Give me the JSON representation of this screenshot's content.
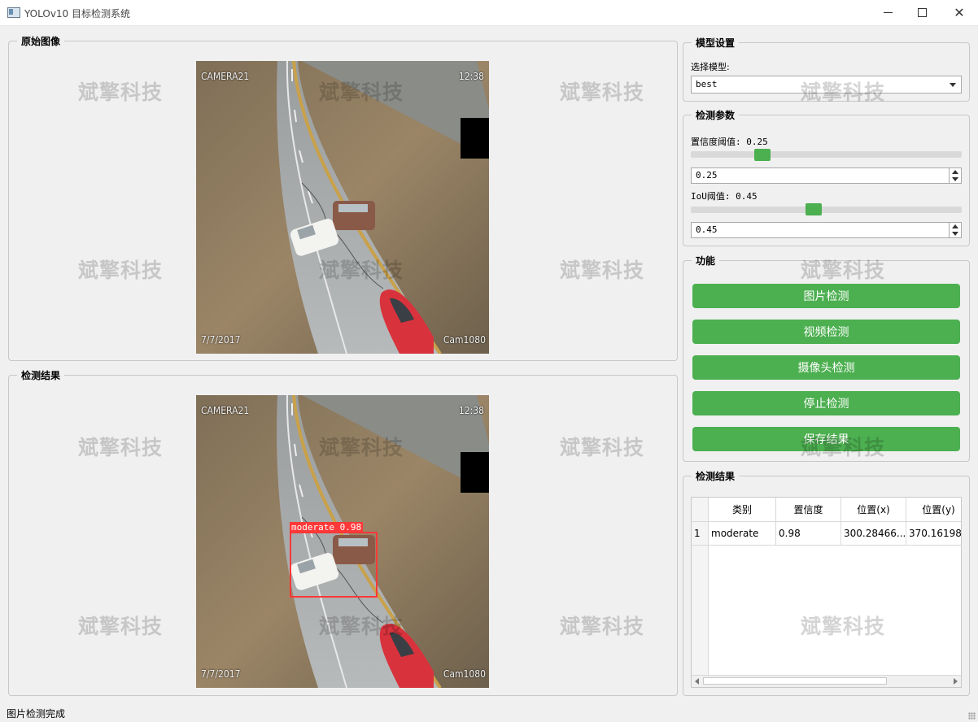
{
  "window": {
    "title": "YOLOv10 目标检测系统",
    "minimize_label": "—",
    "maximize_label": "☐",
    "close_label": "✕"
  },
  "watermark": "斌擎科技",
  "original_panel": {
    "title": "原始图像"
  },
  "result_panel": {
    "title": "检测结果"
  },
  "camera_overlay": {
    "camera": "CAMERA21",
    "time": "12:38",
    "date": "7/7/2017",
    "cam_id": "Cam1080"
  },
  "detection": {
    "label": "moderate 0.98"
  },
  "model_settings": {
    "title": "模型设置",
    "select_label": "选择模型:",
    "selected_model": "best"
  },
  "detection_params": {
    "title": "检测参数",
    "conf_label": "置信度阈值: 0.25",
    "conf_value": "0.25",
    "conf_level": 0.25,
    "iou_label": "IoU阈值: 0.45",
    "iou_value": "0.45",
    "iou_level": 0.45
  },
  "functions": {
    "title": "功能",
    "image_detect": "图片检测",
    "video_detect": "视频检测",
    "camera_detect": "摄像头检测",
    "stop_detect": "停止检测",
    "save_results": "保存结果"
  },
  "results_table": {
    "title": "检测结果",
    "columns": [
      "类别",
      "置信度",
      "位置(x)",
      "位置(y)"
    ],
    "rows": [
      {
        "index": "1",
        "class": "moderate",
        "confidence": "0.98",
        "x": "300.28466...",
        "y": "370.16198..."
      }
    ]
  },
  "status_bar": {
    "text": "图片检测完成"
  },
  "colors": {
    "accent_green": "#4caf50",
    "detection_red": "#ff3838"
  }
}
